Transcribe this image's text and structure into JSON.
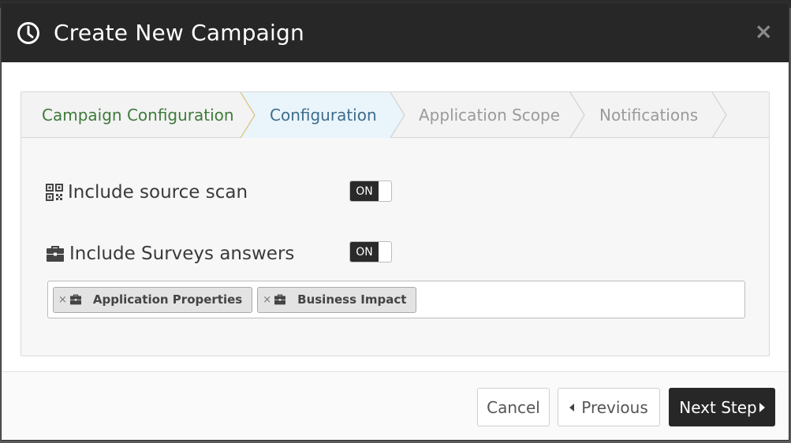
{
  "modal": {
    "title": "Create New Campaign",
    "close_label": "×"
  },
  "steps": [
    {
      "label": "Campaign Configuration",
      "state": "completed"
    },
    {
      "label": "Configuration",
      "state": "active"
    },
    {
      "label": "Application Scope",
      "state": "pending"
    },
    {
      "label": "Notifications",
      "state": "pending"
    }
  ],
  "options": {
    "source_scan": {
      "label": "Include source scan",
      "toggle": "ON",
      "icon": "qrcode-icon"
    },
    "surveys": {
      "label": "Include Surveys answers",
      "toggle": "ON",
      "icon": "briefcase-icon"
    }
  },
  "tags": [
    {
      "label": "Application Properties",
      "remove": "×",
      "icon": "briefcase-icon"
    },
    {
      "label": "Business Impact",
      "remove": "×",
      "icon": "briefcase-icon"
    }
  ],
  "footer": {
    "cancel_label": "Cancel",
    "previous_label": "Previous",
    "next_label": "Next Step"
  },
  "colors": {
    "header_bg": "#272727",
    "completed_step": "#3f7a3a",
    "active_step": "#3c6d8e",
    "active_step_bg": "#eaf4fb"
  }
}
